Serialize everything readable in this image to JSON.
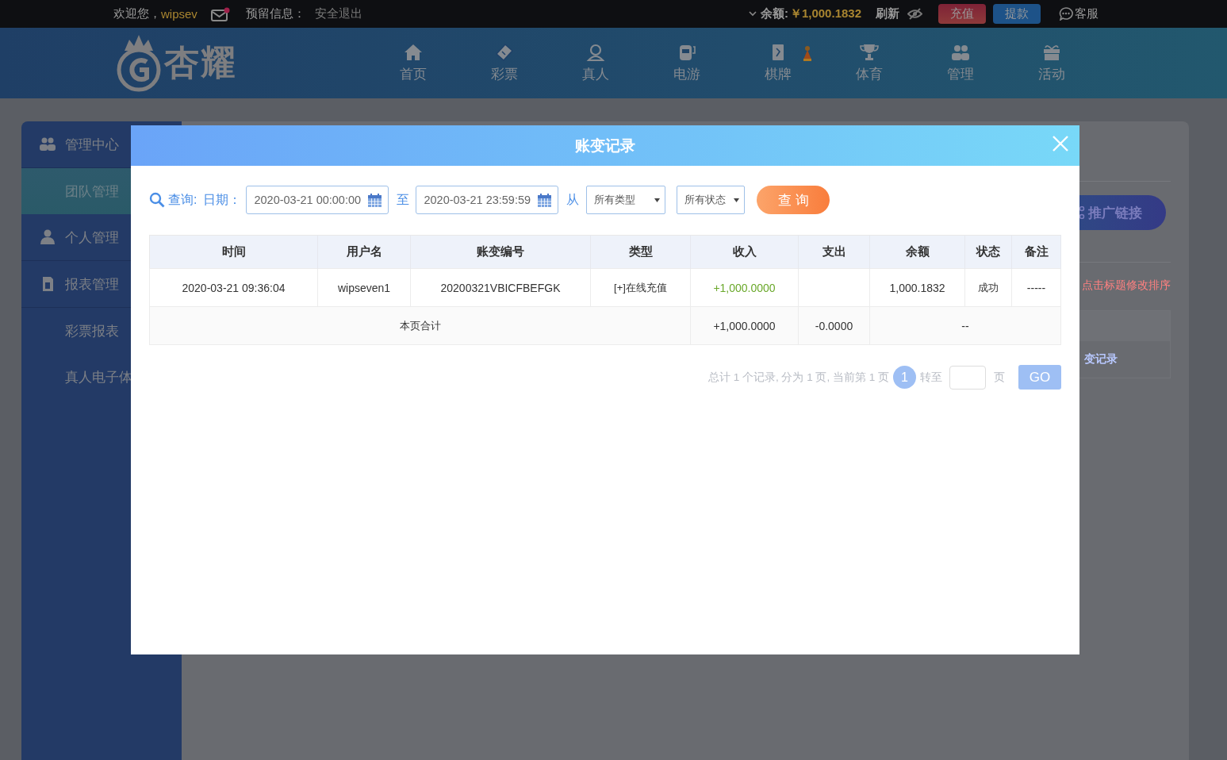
{
  "topbar": {
    "welcome": "欢迎您，",
    "username": "wipsev",
    "mail_unread": true,
    "reserved_label": "预留信息：",
    "logout": "安全退出",
    "balance_label": "余额:",
    "balance": "￥1,000.1832",
    "refresh": "刷新",
    "recharge": "充值",
    "withdraw": "提款",
    "service": "客服"
  },
  "logo": {
    "text": "杏耀"
  },
  "nav": [
    {
      "label": "首页",
      "kind": "home"
    },
    {
      "label": "彩票",
      "kind": "ticket"
    },
    {
      "label": "真人",
      "kind": "person"
    },
    {
      "label": "电游",
      "kind": "slot"
    },
    {
      "label": "棋牌",
      "kind": "cards"
    },
    {
      "label": "体育",
      "kind": "trophy"
    },
    {
      "label": "管理",
      "kind": "group"
    },
    {
      "label": "活动",
      "kind": "gift"
    }
  ],
  "sidebar": {
    "items": [
      {
        "label": "管理中心",
        "kind": "group",
        "expanded": true,
        "selected": false,
        "children": [
          {
            "label": "团队管理",
            "selected": true
          }
        ]
      },
      {
        "label": "个人管理",
        "kind": "person",
        "selected": false
      },
      {
        "label": "报表管理",
        "kind": "report",
        "expanded": true,
        "selected": false,
        "children": [
          {
            "label": "彩票报表",
            "selected": false
          },
          {
            "label": "真人电子体",
            "selected": false
          }
        ]
      }
    ]
  },
  "background": {
    "promo_button": "推广链接",
    "hint": "点击标题修改排序",
    "link": "变记录"
  },
  "modal": {
    "title": "账变记录",
    "filters": {
      "query_label": "查询:",
      "date_label": "日期：",
      "date_from": "2020-03-21 00:00:00",
      "to_label": "至",
      "date_to": "2020-03-21 23:59:59",
      "from_label": "从",
      "type_select": "所有类型",
      "status_select": "所有状态",
      "search_button": "查 询"
    },
    "table": {
      "columns": [
        "时间",
        "用户名",
        "账变编号",
        "类型",
        "收入",
        "支出",
        "余额",
        "状态",
        "备注"
      ],
      "rows": [
        {
          "kind": "record",
          "cells": [
            "2020-03-21 09:36:04",
            "wipseven1",
            "20200321VBICFBEFGK",
            "[+]在线充值",
            "+1,000.0000",
            "",
            "1,000.1832",
            "成功",
            "-----"
          ]
        }
      ],
      "summary": {
        "label": "本页合计",
        "income": "+1,000.0000",
        "expense": "-0.0000",
        "rest": "--"
      }
    },
    "pagination": {
      "summary": "总计 1 个记录, 分为 1 页, 当前第 1 页",
      "pages": [
        {
          "label": "1",
          "selected": true
        }
      ],
      "goto_label": "转至",
      "page_unit": "页",
      "go": "GO"
    }
  }
}
